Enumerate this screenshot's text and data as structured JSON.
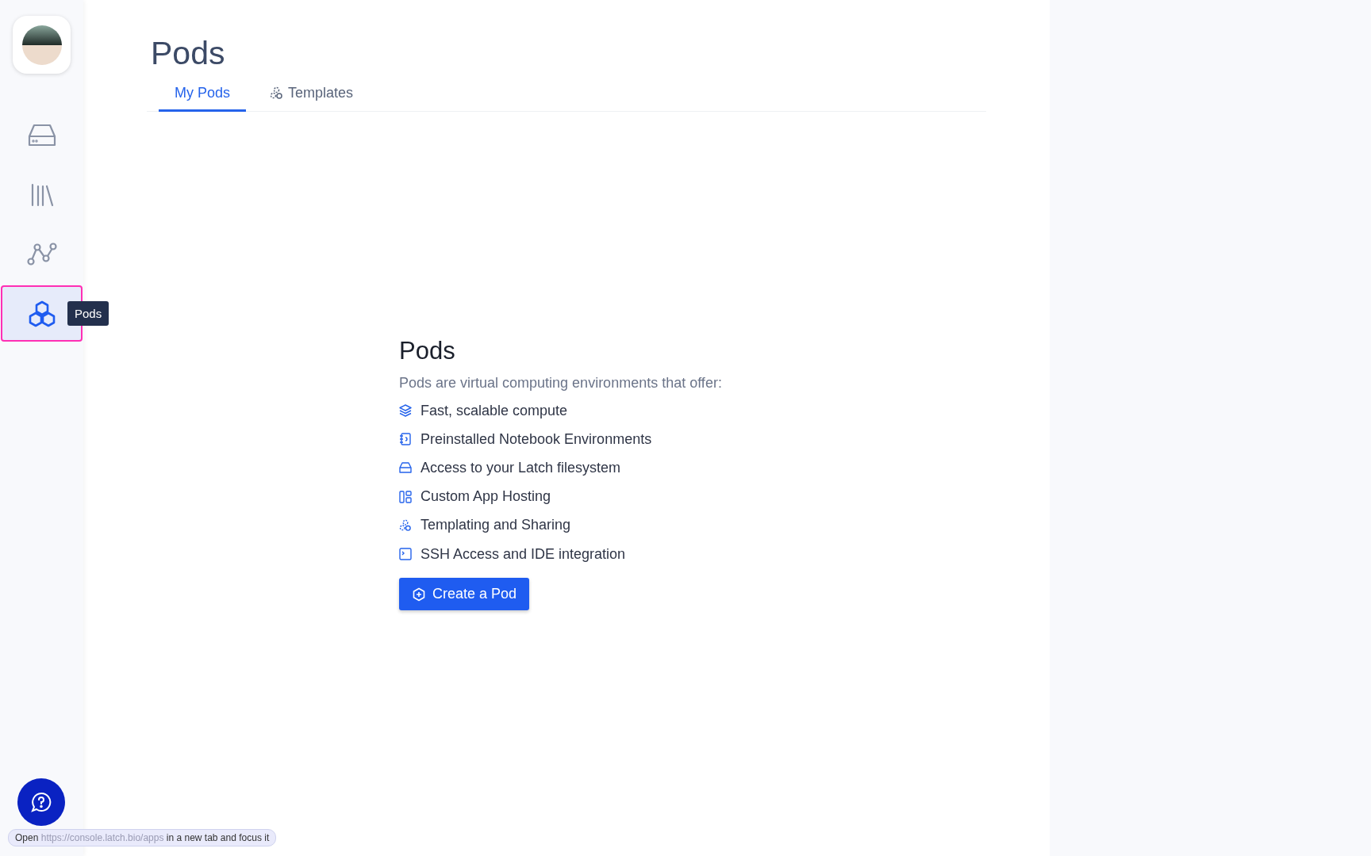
{
  "sidebar": {
    "items": [
      {
        "kind": "drive",
        "selected": false
      },
      {
        "kind": "library",
        "selected": false
      },
      {
        "kind": "graph",
        "selected": false
      },
      {
        "kind": "pods",
        "selected": true
      }
    ],
    "tooltip": "Pods"
  },
  "page": {
    "title": "Pods",
    "tabs": [
      {
        "label": "My Pods",
        "kind": "plain",
        "selected": true
      },
      {
        "label": "Templates",
        "kind": "template",
        "selected": false
      }
    ]
  },
  "empty_state": {
    "heading": "Pods",
    "intro": "Pods are virtual computing environments that offer:",
    "features": [
      {
        "kind": "layers",
        "label": "Fast, scalable compute"
      },
      {
        "kind": "notebook",
        "label": "Preinstalled Notebook Environments"
      },
      {
        "kind": "drive",
        "label": "Access to your Latch filesystem"
      },
      {
        "kind": "apps",
        "label": "Custom App Hosting"
      },
      {
        "kind": "template",
        "label": "Templating and Sharing"
      },
      {
        "kind": "terminal",
        "label": "SSH Access and IDE integration"
      }
    ],
    "button": "Create a Pod"
  },
  "status_bar": {
    "prefix": "Open",
    "url": "https://console.latch.bio/apps",
    "suffix": "in a new tab and focus it"
  }
}
